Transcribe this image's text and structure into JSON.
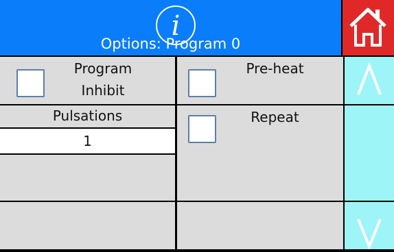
{
  "header": {
    "title": "Options: Program 0",
    "info_icon": "info-icon",
    "home_icon": "home-icon"
  },
  "options": {
    "program_inhibit": {
      "label_line1": "Program",
      "label_line2": "Inhibit",
      "checked": false
    },
    "pre_heat": {
      "label": "Pre-heat",
      "checked": false
    },
    "pulsations": {
      "label": "Pulsations",
      "value": "1"
    },
    "repeat": {
      "label": "Repeat",
      "checked": false
    }
  },
  "scroll": {
    "up_icon": "chevron-up-icon",
    "down_icon": "chevron-down-icon"
  },
  "colors": {
    "header_bg": "#0a7dfa",
    "home_bg": "#e02828",
    "cell_bg": "#dcdcdc",
    "scroll_bg": "#9df5f8"
  }
}
